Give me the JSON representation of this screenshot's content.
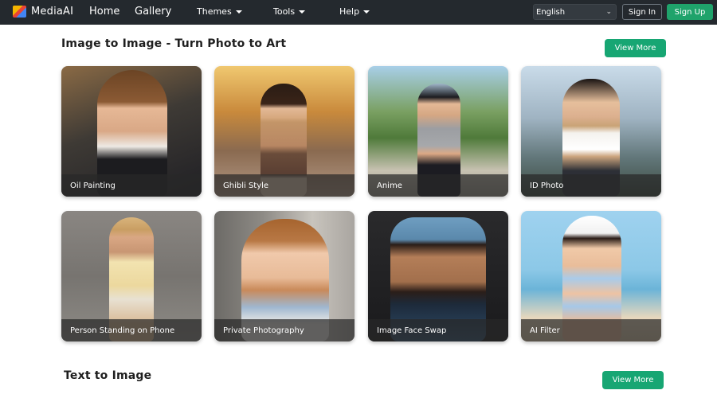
{
  "navbar": {
    "brand": "MediaAI",
    "links": [
      "Home",
      "Gallery"
    ],
    "dropdowns": [
      "Themes",
      "Tools",
      "Help"
    ],
    "language": "English",
    "signin": "Sign In",
    "signup": "Sign Up"
  },
  "sections": [
    {
      "title": "Image to Image - Turn Photo to Art",
      "view_more": "View More",
      "cards": [
        {
          "caption": "Oil Painting"
        },
        {
          "caption": "Ghibli Style"
        },
        {
          "caption": "Anime"
        },
        {
          "caption": "ID Photo"
        },
        {
          "caption": "Person Standing on Phone"
        },
        {
          "caption": "Private Photography"
        },
        {
          "caption": "Image Face Swap"
        },
        {
          "caption": "AI Filter"
        }
      ]
    },
    {
      "title": "Text to Image",
      "view_more": "View More"
    }
  ],
  "colors": {
    "navbar_bg": "#24292e",
    "accent": "#17a673"
  }
}
